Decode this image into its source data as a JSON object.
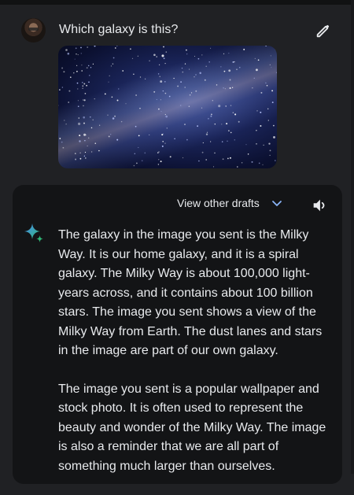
{
  "prompt": {
    "text": "Which galaxy is this?"
  },
  "response": {
    "view_drafts_label": "View other drafts",
    "paragraphs": [
      "The galaxy in the image you sent is the Milky Way. It is our home galaxy, and it is a spiral galaxy. The Milky Way is about 100,000 light-years across, and it contains about 100 billion stars. The image you sent shows a view of the Milky Way from Earth. The dust lanes and stars in the image are part of our own galaxy.",
      "The image you sent is a popular wallpaper and stock photo. It is often used to represent the beauty and wonder of the Milky Way. The image is also a reminder that we are all part of something much larger than ourselves."
    ]
  },
  "icons": {
    "edit": "pencil-icon",
    "drafts_toggle": "chevron-down-icon",
    "read_aloud": "speaker-icon",
    "assistant": "sparkle-icon"
  },
  "colors": {
    "background": "#202124",
    "response_card": "#131416",
    "text": "#e8eaed",
    "sparkle_blue": "#4a8df0",
    "sparkle_green": "#2fb877"
  }
}
